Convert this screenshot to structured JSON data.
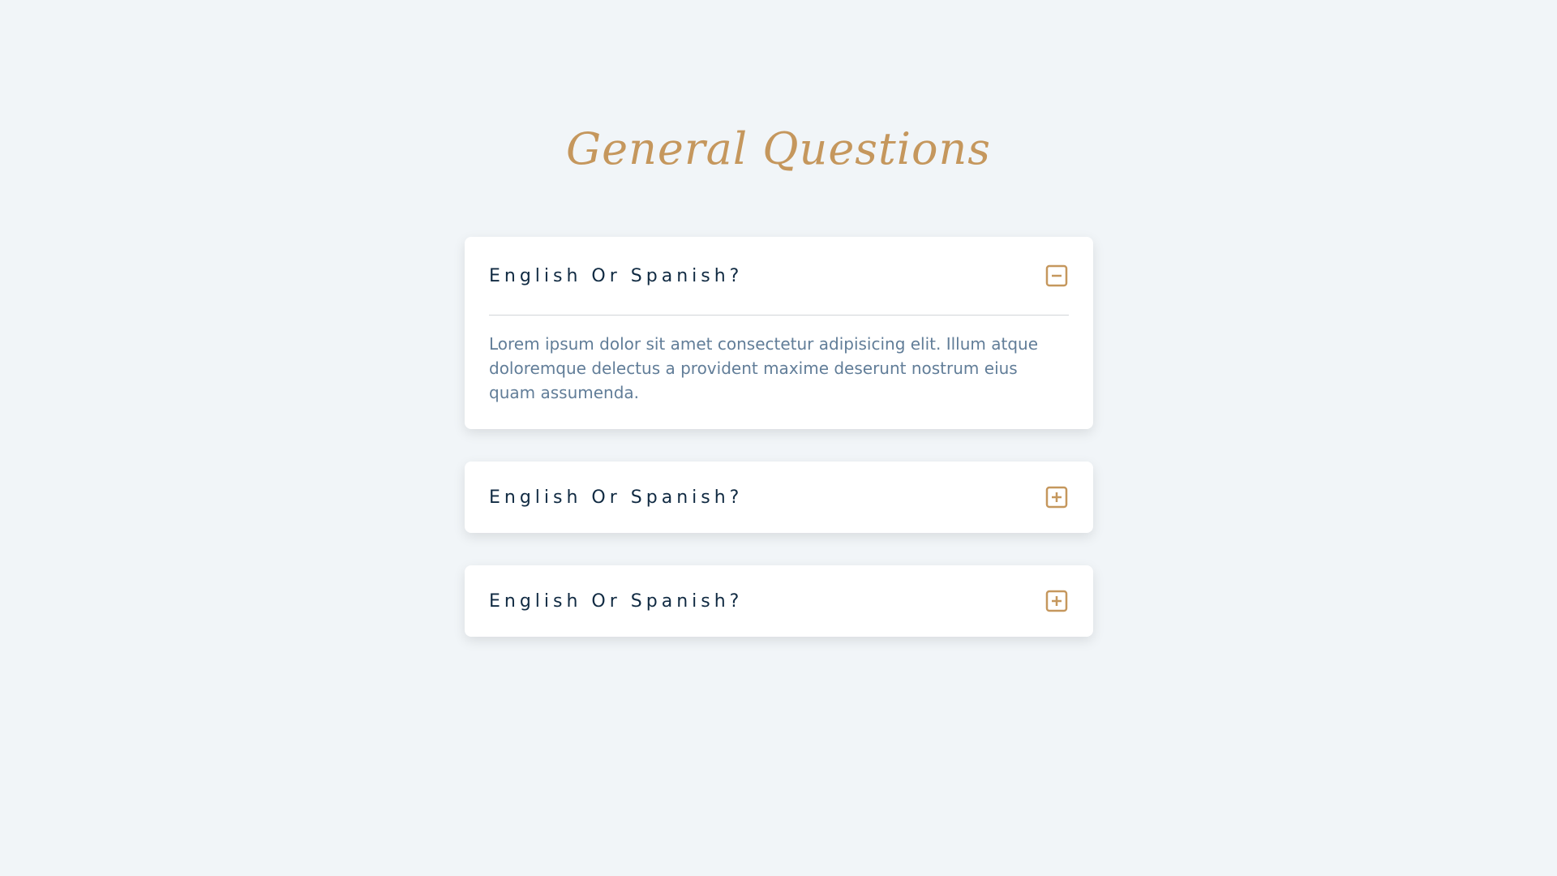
{
  "page": {
    "title": "General Questions",
    "accent_color": "#c5975d",
    "background_color": "#f1f5f8"
  },
  "faq": [
    {
      "question": "English Or Spanish?",
      "answer": "Lorem ipsum dolor sit amet consectetur adipisicing elit. Illum atque doloremque delectus a provident maxime deserunt nostrum eius quam assumenda.",
      "expanded": true,
      "icon": "minus-square-icon"
    },
    {
      "question": "English Or Spanish?",
      "expanded": false,
      "icon": "plus-square-icon"
    },
    {
      "question": "English Or Spanish?",
      "expanded": false,
      "icon": "plus-square-icon"
    }
  ]
}
